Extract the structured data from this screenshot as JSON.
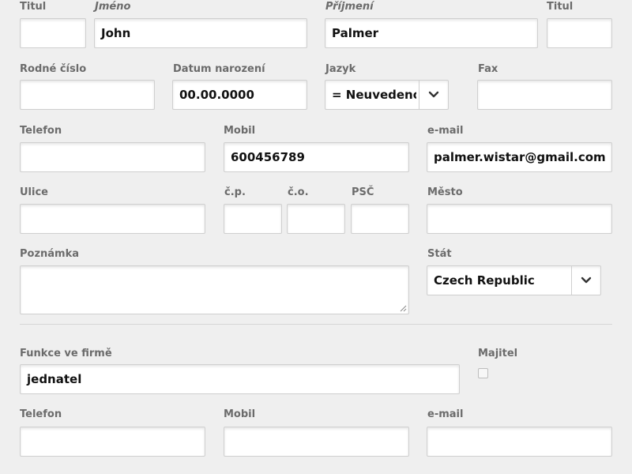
{
  "personal": {
    "title_before_label": "Titul",
    "title_before_value": "",
    "first_name_label": "Jméno",
    "first_name_value": "John",
    "last_name_label": "Příjmení",
    "last_name_value": "Palmer",
    "title_after_label": "Titul",
    "title_after_value": "",
    "birth_number_label": "Rodné číslo",
    "birth_number_value": "",
    "birth_date_label": "Datum narození",
    "birth_date_value": "00.00.0000",
    "language_label": "Jazyk",
    "language_value": "= Neuvedeno",
    "fax_label": "Fax",
    "fax_value": "",
    "phone_label": "Telefon",
    "phone_value": "",
    "mobile_label": "Mobil",
    "mobile_value": "600456789",
    "email_label": "e-mail",
    "email_value": "palmer.wistar@gmail.com",
    "street_label": "Ulice",
    "street_value": "",
    "cp_label": "č.p.",
    "cp_value": "",
    "co_label": "č.o.",
    "co_value": "",
    "psc_label": "PSČ",
    "psc_value": "",
    "city_label": "Město",
    "city_value": "",
    "note_label": "Poznámka",
    "note_value": "",
    "country_label": "Stát",
    "country_value": "Czech Republic"
  },
  "company": {
    "function_label": "Funkce ve firmě",
    "function_value": "jednatel",
    "owner_label": "Majitel",
    "owner_checked": false,
    "phone_label": "Telefon",
    "phone_value": "",
    "mobile_label": "Mobil",
    "mobile_value": "",
    "email_label": "e-mail",
    "email_value": ""
  },
  "icons": {
    "dropdown": "chevron-down-icon",
    "resize": "resize-grip-icon"
  },
  "colors": {
    "background": "#efefef",
    "label": "#6b6b6b",
    "input_border": "#cfcfcf",
    "value_text": "#111111"
  }
}
